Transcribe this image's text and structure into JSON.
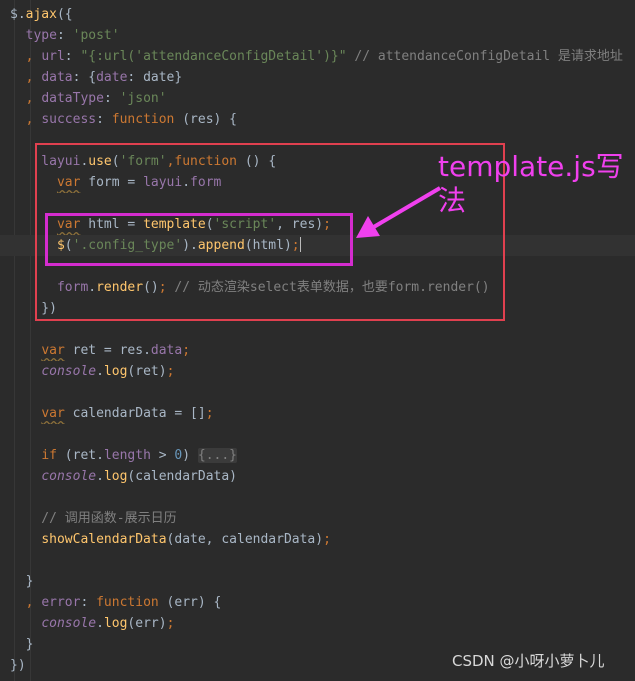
{
  "editor": {
    "lines": [
      [
        {
          "t": "$",
          "c": "t-def"
        },
        {
          "t": ".",
          "c": "t-def"
        },
        {
          "t": "ajax",
          "c": "t-fn"
        },
        {
          "t": "({",
          "c": "t-def"
        }
      ],
      [
        {
          "t": "  ",
          "c": "t-def"
        },
        {
          "t": "type",
          "c": "t-prop"
        },
        {
          "t": ": ",
          "c": "t-def"
        },
        {
          "t": "'post'",
          "c": "t-str"
        }
      ],
      [
        {
          "t": "  , ",
          "c": "t-kw"
        },
        {
          "t": "url",
          "c": "t-prop"
        },
        {
          "t": ": ",
          "c": "t-def"
        },
        {
          "t": "\"{:url('attendanceConfigDetail')}\"",
          "c": "t-str"
        },
        {
          "t": " // attendanceConfigDetail 是请求地址",
          "c": "t-cm"
        }
      ],
      [
        {
          "t": "  , ",
          "c": "t-kw"
        },
        {
          "t": "data",
          "c": "t-prop"
        },
        {
          "t": ": {",
          "c": "t-def"
        },
        {
          "t": "date",
          "c": "t-prop"
        },
        {
          "t": ": date}",
          "c": "t-def"
        }
      ],
      [
        {
          "t": "  , ",
          "c": "t-kw"
        },
        {
          "t": "dataType",
          "c": "t-prop"
        },
        {
          "t": ": ",
          "c": "t-def"
        },
        {
          "t": "'json'",
          "c": "t-str"
        }
      ],
      [
        {
          "t": "  , ",
          "c": "t-kw"
        },
        {
          "t": "success",
          "c": "t-prop"
        },
        {
          "t": ": ",
          "c": "t-def"
        },
        {
          "t": "function",
          "c": "t-kw"
        },
        {
          "t": " (res) {",
          "c": "t-def"
        }
      ],
      [],
      [
        {
          "t": "    layui",
          "c": "t-prop"
        },
        {
          "t": ".",
          "c": "t-def"
        },
        {
          "t": "use",
          "c": "t-fn"
        },
        {
          "t": "(",
          "c": "t-def"
        },
        {
          "t": "'form'",
          "c": "t-str"
        },
        {
          "t": ",",
          "c": "t-kw"
        },
        {
          "t": "function",
          "c": "t-kw"
        },
        {
          "t": " () {",
          "c": "t-def"
        }
      ],
      [
        {
          "t": "      ",
          "c": "t-def"
        },
        {
          "t": "var",
          "c": "t-kw wavy"
        },
        {
          "t": " form = ",
          "c": "t-def"
        },
        {
          "t": "layui",
          "c": "t-prop"
        },
        {
          "t": ".",
          "c": "t-def"
        },
        {
          "t": "form",
          "c": "t-prop"
        }
      ],
      [],
      [
        {
          "t": "      ",
          "c": "t-def"
        },
        {
          "t": "var",
          "c": "t-kw wavy"
        },
        {
          "t": " html = ",
          "c": "t-def"
        },
        {
          "t": "template",
          "c": "t-fn"
        },
        {
          "t": "(",
          "c": "t-def"
        },
        {
          "t": "'script'",
          "c": "t-str"
        },
        {
          "t": ", res)",
          "c": "t-def"
        },
        {
          "t": ";",
          "c": "t-kw"
        }
      ],
      [
        {
          "t": "      ",
          "c": "t-def"
        },
        {
          "t": "$",
          "c": "t-fn"
        },
        {
          "t": "(",
          "c": "t-def"
        },
        {
          "t": "'.config_type'",
          "c": "t-str"
        },
        {
          "t": ").",
          "c": "t-def"
        },
        {
          "t": "append",
          "c": "t-fn"
        },
        {
          "t": "(html)",
          "c": "t-def"
        },
        {
          "t": ";",
          "c": "t-kw"
        },
        {
          "t": "|",
          "c": "caret"
        }
      ],
      [],
      [
        {
          "t": "      ",
          "c": "t-def"
        },
        {
          "t": "form",
          "c": "t-prop"
        },
        {
          "t": ".",
          "c": "t-def"
        },
        {
          "t": "render",
          "c": "t-fn"
        },
        {
          "t": "()",
          "c": "t-def"
        },
        {
          "t": ";",
          "c": "t-kw"
        },
        {
          "t": " // 动态渲染select表单数据，也要form.render()",
          "c": "t-cm"
        }
      ],
      [
        {
          "t": "    })",
          "c": "t-def"
        }
      ],
      [],
      [
        {
          "t": "    ",
          "c": "t-def"
        },
        {
          "t": "var",
          "c": "t-kw wavy"
        },
        {
          "t": " ret = res.",
          "c": "t-def"
        },
        {
          "t": "data",
          "c": "t-prop"
        },
        {
          "t": ";",
          "c": "t-kw"
        }
      ],
      [
        {
          "t": "    ",
          "c": "t-def"
        },
        {
          "t": "console",
          "c": "t-it"
        },
        {
          "t": ".",
          "c": "t-def"
        },
        {
          "t": "log",
          "c": "t-fn"
        },
        {
          "t": "(ret)",
          "c": "t-def"
        },
        {
          "t": ";",
          "c": "t-kw"
        }
      ],
      [],
      [
        {
          "t": "    ",
          "c": "t-def"
        },
        {
          "t": "var",
          "c": "t-kw wavy"
        },
        {
          "t": " calendarData = []",
          "c": "t-def"
        },
        {
          "t": ";",
          "c": "t-kw"
        }
      ],
      [],
      [
        {
          "t": "    ",
          "c": "t-def"
        },
        {
          "t": "if",
          "c": "t-kw"
        },
        {
          "t": " (ret.",
          "c": "t-def"
        },
        {
          "t": "length",
          "c": "t-prop"
        },
        {
          "t": " > ",
          "c": "t-def"
        },
        {
          "t": "0",
          "c": "t-num"
        },
        {
          "t": ") ",
          "c": "t-def"
        },
        {
          "t": "{...}",
          "c": "t-fold"
        }
      ],
      [
        {
          "t": "    ",
          "c": "t-def"
        },
        {
          "t": "console",
          "c": "t-it"
        },
        {
          "t": ".",
          "c": "t-def"
        },
        {
          "t": "log",
          "c": "t-fn"
        },
        {
          "t": "(calendarData)",
          "c": "t-def"
        }
      ],
      [],
      [
        {
          "t": "    // 调用函数-展示日历",
          "c": "t-cm"
        }
      ],
      [
        {
          "t": "    ",
          "c": "t-def"
        },
        {
          "t": "showCalendarData",
          "c": "t-fn"
        },
        {
          "t": "(date, calendarData)",
          "c": "t-def"
        },
        {
          "t": ";",
          "c": "t-kw"
        }
      ],
      [],
      [
        {
          "t": "  }",
          "c": "t-def"
        }
      ],
      [
        {
          "t": "  , ",
          "c": "t-kw"
        },
        {
          "t": "error",
          "c": "t-prop"
        },
        {
          "t": ": ",
          "c": "t-def"
        },
        {
          "t": "function",
          "c": "t-kw"
        },
        {
          "t": " (err) {",
          "c": "t-def"
        }
      ],
      [
        {
          "t": "    ",
          "c": "t-def"
        },
        {
          "t": "console",
          "c": "t-it"
        },
        {
          "t": ".",
          "c": "t-def"
        },
        {
          "t": "log",
          "c": "t-fn"
        },
        {
          "t": "(err)",
          "c": "t-def"
        },
        {
          "t": ";",
          "c": "t-kw"
        }
      ],
      [
        {
          "t": "  }",
          "c": "t-def"
        }
      ],
      [
        {
          "t": "})",
          "c": "t-def"
        }
      ]
    ],
    "current_line": 11
  },
  "annotation": {
    "text": "template.js写法",
    "color": "#f040ee"
  },
  "watermark": "CSDN @小呀小萝卜儿"
}
